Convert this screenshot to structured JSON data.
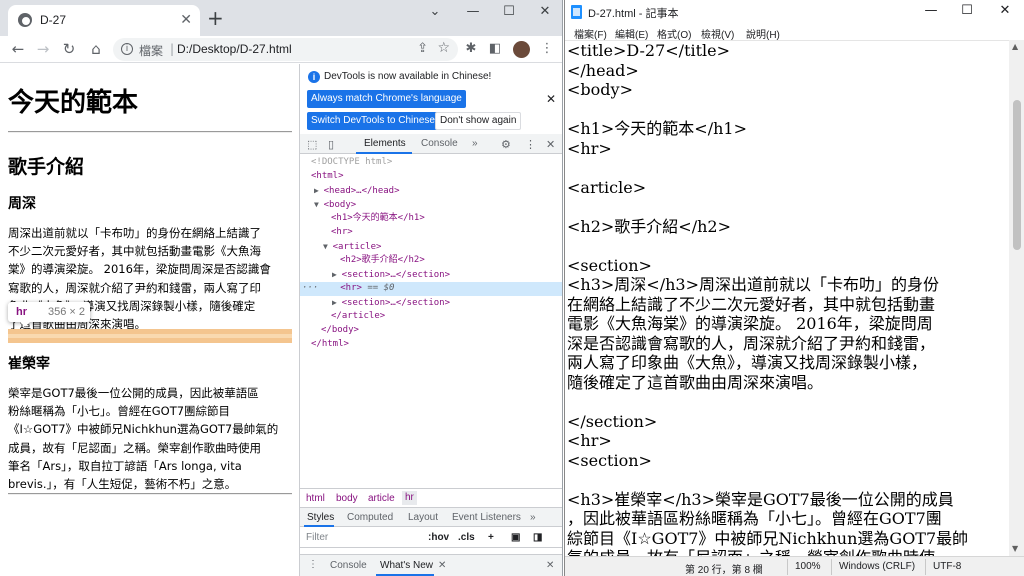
{
  "browser": {
    "tab_title": "D-27",
    "tab_close": "✕",
    "new_tab": "+",
    "window_controls": [
      "⌄",
      "—",
      "☐",
      "✕"
    ],
    "nav": {
      "back": "←",
      "forward": "→",
      "reload": "↻",
      "home": "⌂"
    },
    "omnibox": {
      "scheme_label": "檔案",
      "separator": "|",
      "url": "D:/Desktop/D-27.html"
    },
    "toolbar_icons": [
      "puzzle-icon",
      "sidebar-icon",
      "menu-icon"
    ]
  },
  "page": {
    "h1": "今天的範本",
    "h2": "歌手介紹",
    "section1": {
      "h3": "周深",
      "lines": [
        "周深出道前就以「卡布叻」的身份在網絡上結識了",
        "不少二次元愛好者，其中就包括動畫電影《大魚海",
        "棠》的導演梁旋。 2016年，梁旋問周深是否認識會",
        "寫歌的人，周深就介紹了尹約和錢雷，兩人寫了印",
        "象曲《大魚》，導演又找周深錄製小樣，隨後確定",
        "了這首歌曲由周深來演唱。"
      ]
    },
    "section2": {
      "h3": "崔榮宰",
      "lines": [
        "榮宰是GOT7最後一位公開的成員，因此被華語區",
        "粉絲暱稱為「小七」。曾經在GOT7團綜節目",
        "《I☆GOT7》中被師兄Nichkhun選為GOT7最帥氣的",
        "成員，故有「尼認面」之稱。榮宰創作歌曲時使用",
        "筆名「Ars」，取自拉丁諺語「Ars longa, vita",
        "brevis.」，有「人生短促，藝術不朽」之意。"
      ]
    },
    "tooltip": {
      "tag": "hr",
      "size": "356 × 2"
    }
  },
  "devtools": {
    "banner_message": "DevTools is now available in Chinese!",
    "btn_match": "Always match Chrome's language",
    "btn_switch": "Switch DevTools to Chinese",
    "btn_dont_show": "Don't show again",
    "banner_close": "✕",
    "tabs": {
      "elements": "Elements",
      "console": "Console",
      "more": "»"
    },
    "dom": {
      "doctype": "<!DOCTYPE html>",
      "html_open": "<html>",
      "head": "<head>…</head>",
      "body_open": "<body>",
      "h1": "<h1>今天的範本</h1>",
      "hr1": "<hr>",
      "article_open": "<article>",
      "h2": "<h2>歌手介紹</h2>",
      "section1": "<section>…</section>",
      "hr_selected": "<hr>",
      "eq_marker": "== $0",
      "ellipsis": "···",
      "section2": "<section>…</section>",
      "article_close": "</article>",
      "body_close": "</body>",
      "html_close": "</html>"
    },
    "breadcrumbs": [
      "html",
      "body",
      "article",
      "hr"
    ],
    "sub_tabs": [
      "Styles",
      "Computed",
      "Layout",
      "Event Listeners",
      "»"
    ],
    "filter_placeholder": "Filter",
    "hov": ":hov",
    "cls": ".cls",
    "drawer_tabs": [
      "Console",
      "What's New"
    ],
    "drawer_close": "✕"
  },
  "notepad": {
    "title": "D-27.html - 記事本",
    "window_controls": [
      "—",
      "☐",
      "✕"
    ],
    "menu": [
      "檔案(F)",
      "編輯(E)",
      "格式(O)",
      "檢視(V)",
      "說明(H)"
    ],
    "lines": [
      "  <title>D-27</title>",
      "</head>",
      "<body>",
      "",
      "  <h1>今天的範本</h1>",
      "  <hr>",
      "",
      "  <article>",
      "",
      "  <h2>歌手介紹</h2>",
      "",
      "  <section>",
      "  <h3>周深</h3>周深出道前就以「卡布叻」的身份",
      "在網絡上結識了不少二次元愛好者，其中就包括動畫",
      "電影《大魚海棠》的導演梁旋。 2016年，梁旋問周",
      "深是否認識會寫歌的人，周深就介紹了尹約和錢雷，",
      "兩人寫了印象曲《大魚》，導演又找周深錄製小樣，",
      "隨後確定了這首歌曲由周深來演唱。",
      "",
      "  </section>",
      "  <hr>",
      "  <section>",
      "",
      "  <h3>崔榮宰</h3>榮宰是GOT7最後一位公開的成員",
      "，因此被華語區粉絲暱稱為「小七」。曾經在GOT7團",
      "綜節目《I☆GOT7》中被師兄Nichkhun選為GOT7最帥",
      "氣的成員，故有「尼認面」之稱。榮宰創作歌曲時使"
    ],
    "status": {
      "position": "第 20 行，第 8 欄",
      "zoom": "100%",
      "eol": "Windows (CRLF)",
      "encoding": "UTF-8"
    }
  }
}
